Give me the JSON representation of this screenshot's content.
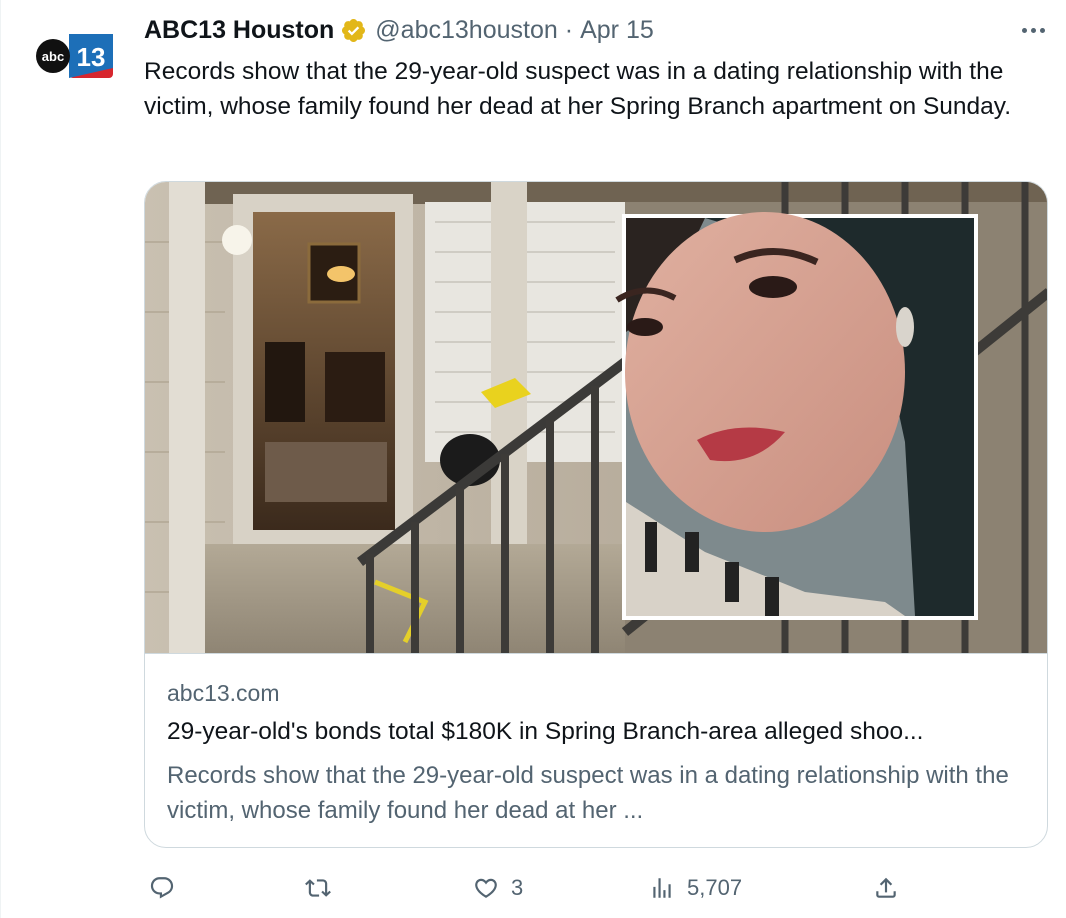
{
  "account": {
    "display_name": "ABC13 Houston",
    "handle": "@abc13houston",
    "separator": "·",
    "date": "Apr 15",
    "avatar_text": "abc13"
  },
  "tweet": {
    "text": "Records show that the 29-year-old suspect was in a dating relationship with the victim, whose family found her dead at her Spring Branch apartment on Sunday."
  },
  "card": {
    "domain": "abc13.com",
    "title": "29-year-old's bonds total $180K in Spring Branch-area alleged shoo...",
    "description": "Records show that the 29-year-old suspect was in a dating relationship with the victim, whose family found her dead at her ..."
  },
  "actions": {
    "reply_count": "",
    "retweet_count": "",
    "like_count": "3",
    "views_count": "5,707"
  },
  "icons": {
    "verified": "verified-gold-badge-icon",
    "more": "more-dots-icon",
    "reply": "reply-icon",
    "retweet": "retweet-icon",
    "like": "heart-icon",
    "views": "views-chart-icon",
    "share": "share-icon"
  },
  "colors": {
    "text": "#0f1419",
    "secondary": "#536471",
    "border": "#cfd9de",
    "verified_gold": "#e2b719",
    "abc_blue": "#1d6fb8",
    "abc_red": "#d7262e"
  }
}
